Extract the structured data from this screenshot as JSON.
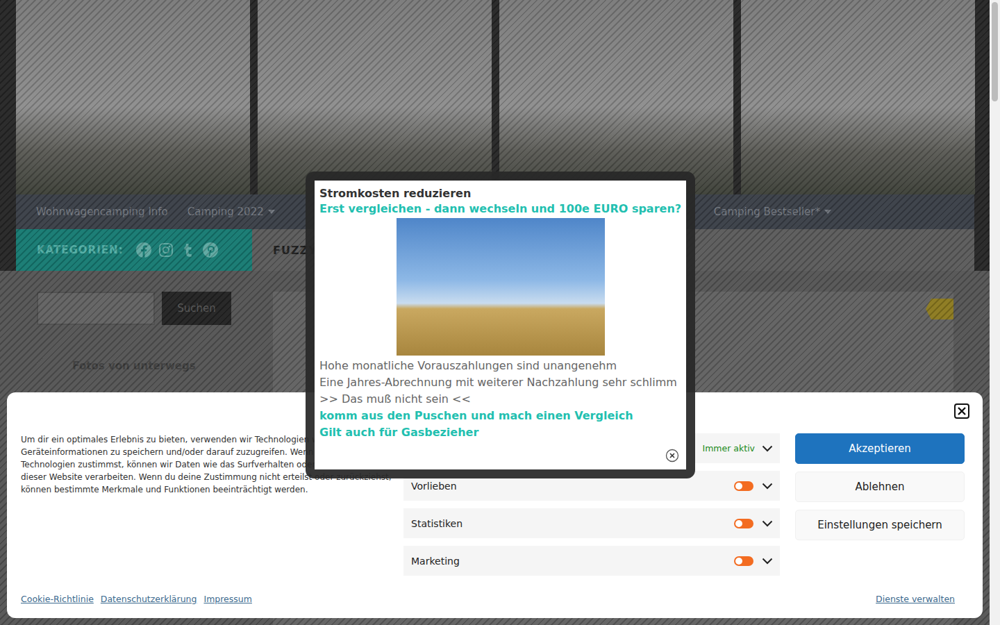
{
  "nav": {
    "items": [
      {
        "label": "Wohnwagencamping Info",
        "has_submenu": false
      },
      {
        "label": "Camping 2022",
        "has_submenu": true
      },
      {
        "label": "Camping Bestseller*",
        "has_submenu": true
      }
    ]
  },
  "category_bar": {
    "label": "KATEGORIEN:",
    "heading": "FUZZY"
  },
  "sidebar": {
    "search_button": "Suchen",
    "widget_title": "Fotos von unterwegs"
  },
  "cookie_banner": {
    "text_lines": [
      "Um dir ein optimales Erlebnis zu bieten, verwenden wir Technologien w",
      "Geräteinformationen zu speichern und/oder darauf zuzugreifen. Wenn",
      "Technologien zustimmst, können wir Daten wie das Surfverhalten oder",
      "dieser Website verarbeiten. Wenn du deine Zustimmung nicht erteilst oder zurückziehst,",
      "können bestimmte Merkmale und Funktionen beeinträchtigt werden."
    ],
    "categories": [
      {
        "kind": "always",
        "status": "Immer aktiv"
      },
      {
        "kind": "toggle",
        "label": "Vorlieben",
        "on": false
      },
      {
        "kind": "toggle",
        "label": "Statistiken",
        "on": false
      },
      {
        "kind": "toggle",
        "label": "Marketing",
        "on": false
      }
    ],
    "buttons": [
      {
        "label": "Akzeptieren",
        "primary": true
      },
      {
        "label": "Ablehnen",
        "primary": false
      },
      {
        "label": "Einstellungen speichern",
        "primary": false
      }
    ],
    "links": [
      "Cookie-Richtlinie",
      "Datenschutzerklärung",
      "Impressum"
    ],
    "manage_link": "Dienste verwalten"
  },
  "popup": {
    "title": "Stromkosten reduzieren",
    "headline": "Erst vergleichen - dann wechseln und 100e EURO sparen?",
    "lines": [
      "Hohe monatliche Vorauszahlungen sind unangenehm",
      "Eine Jahres-Abrechnung mit weiterer Nachzahlung sehr schlimm",
      ">> Das muß nicht sein <<"
    ],
    "cta_lines": [
      "komm aus den Puschen und mach einen Vergleich",
      "Gilt auch für Gasbezieher"
    ]
  }
}
